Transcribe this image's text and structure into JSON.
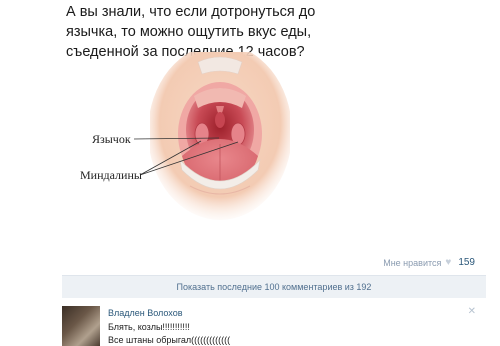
{
  "headline": {
    "line1": "А вы знали, что если дотронуться до",
    "line2": "язычка, то можно ощутить вкус еды,",
    "line3": "съеденной за последние 12 часов?"
  },
  "diagram": {
    "label_uvula": "Язычок",
    "label_tonsils": "Миндалины"
  },
  "likes": {
    "text": "Мне нравится",
    "count": "159",
    "icon": "heart-icon"
  },
  "comments": {
    "show_more": "Показать последние 100 комментариев из 192",
    "items": [
      {
        "author": "Владлен Волохов",
        "line1": "Блять, козлы!!!!!!!!!!!",
        "line2": "Все штаны обрыгал((((((((((((("
      }
    ]
  },
  "colors": {
    "link": "#2b587a",
    "bar_bg": "#edf1f5",
    "muted": "#8a9bb0"
  }
}
